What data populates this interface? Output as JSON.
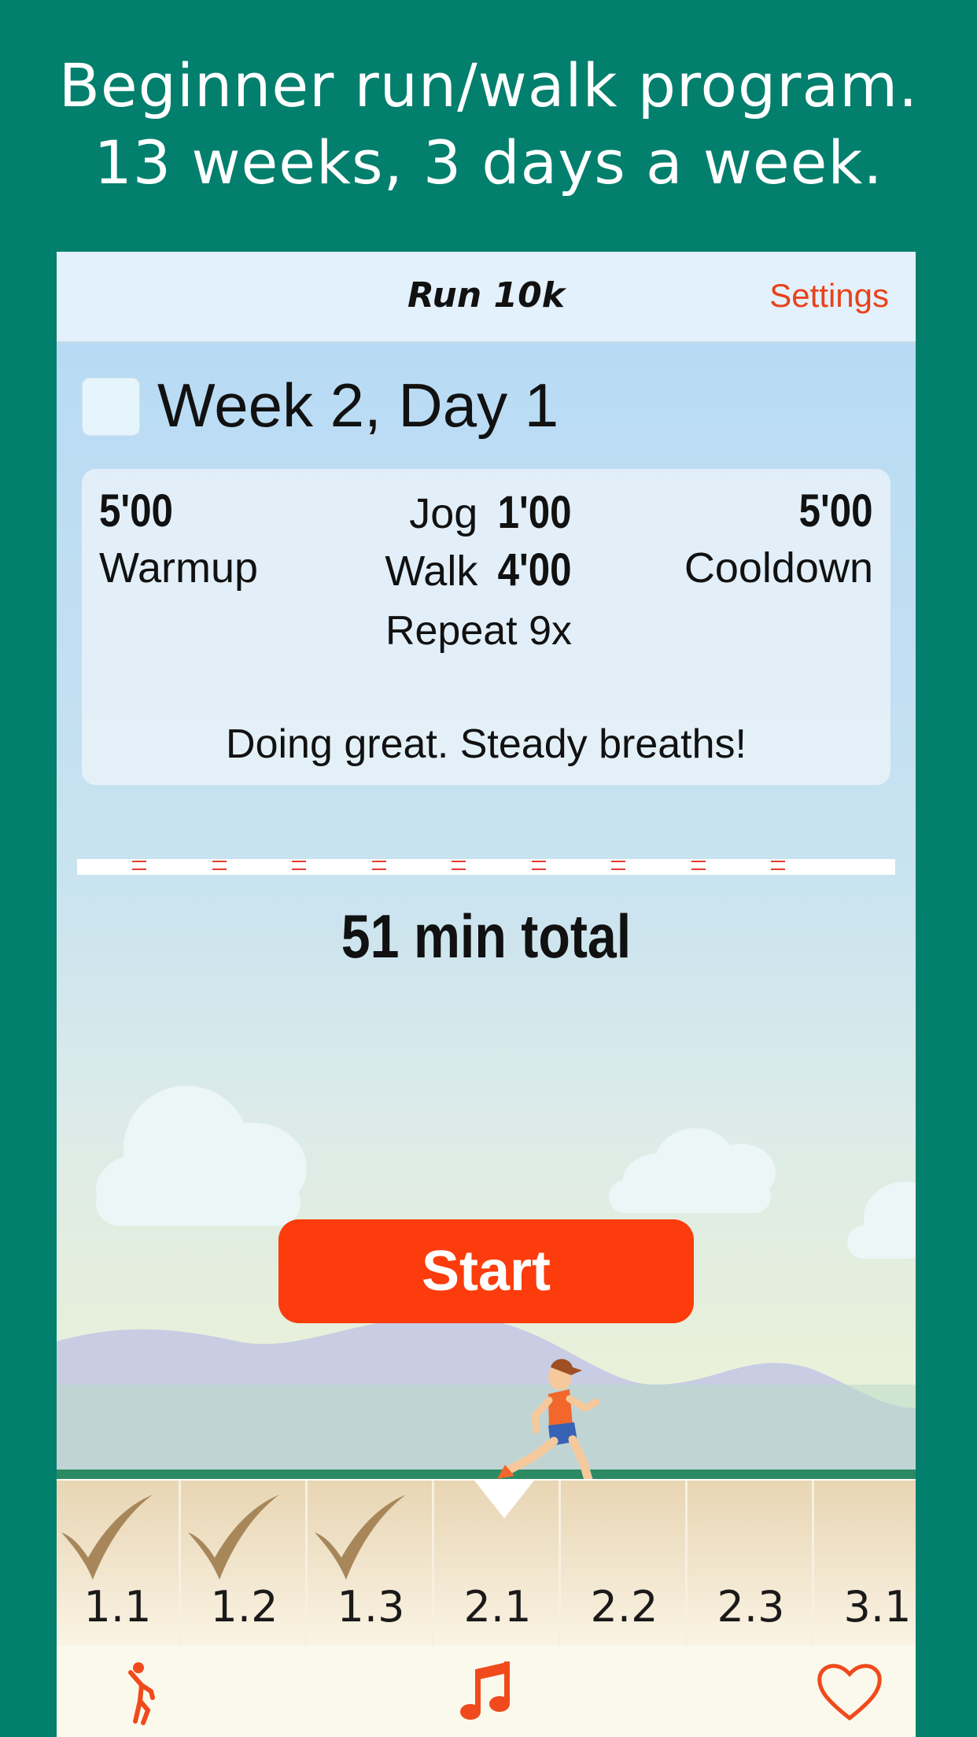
{
  "marketing": {
    "line1": "Beginner run/walk program.",
    "line2": "13 weeks, 3 days a week."
  },
  "nav": {
    "title": "Run 10k",
    "settings_label": "Settings"
  },
  "workout": {
    "day_title": "Week 2, Day 1",
    "completed": false,
    "warmup_time": "5'00",
    "warmup_label": "Warmup",
    "jog_label": "Jog",
    "jog_time": "1'00",
    "walk_label": "Walk",
    "walk_time": "4'00",
    "repeat_label": "Repeat 9x",
    "cooldown_time": "5'00",
    "cooldown_label": "Cooldown",
    "encouragement": "Doing great. Steady breaths!",
    "interval_count": 9,
    "total_label": "51 min total"
  },
  "start_label": "Start",
  "weeks": [
    {
      "label": "1.1",
      "done": true
    },
    {
      "label": "1.2",
      "done": true
    },
    {
      "label": "1.3",
      "done": true
    },
    {
      "label": "2.1",
      "done": false,
      "current": true
    },
    {
      "label": "2.2",
      "done": false
    },
    {
      "label": "2.3",
      "done": false
    },
    {
      "label": "3.1",
      "done": false
    }
  ],
  "tabs": [
    {
      "icon": "stretch-figure-icon"
    },
    {
      "icon": "music-note-icon"
    },
    {
      "icon": "heart-icon"
    }
  ],
  "colors": {
    "brand_background": "#027f6d",
    "accent": "#fc3c0c",
    "settings": "#e9421a"
  }
}
